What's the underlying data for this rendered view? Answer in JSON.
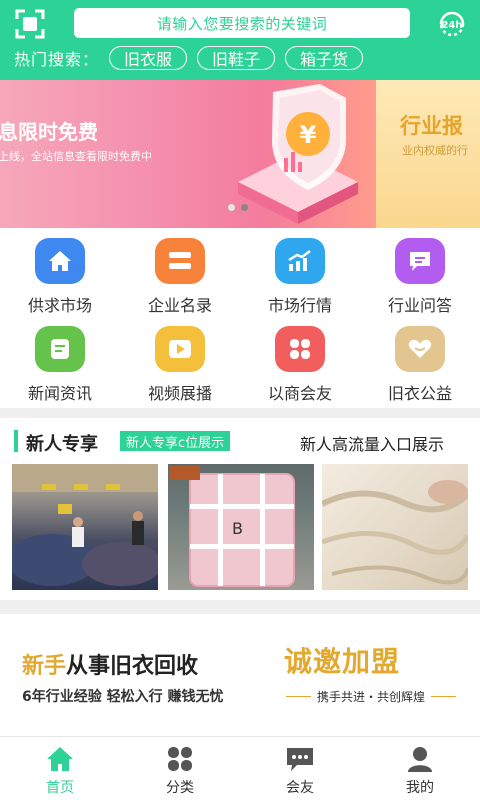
{
  "header": {
    "search_placeholder": "请输入您要搜索的关键词",
    "hot_label": "热门搜索：",
    "hot_tags": [
      "旧衣服",
      "旧鞋子",
      "箱子货"
    ],
    "service_label": "24h",
    "accent": "#2dd296"
  },
  "banner": {
    "slide1_title": "息限时免费",
    "slide1_sub": "上线，全站信息查看限时免费中",
    "slide2_title": "行业报",
    "slide2_sub": "业内权威的行"
  },
  "grid": [
    {
      "label": "供求市场",
      "icon": "home-icon",
      "color": "#3f88f0"
    },
    {
      "label": "企业名录",
      "icon": "list-icon",
      "color": "#f7833a"
    },
    {
      "label": "市场行情",
      "icon": "trend-chart-icon",
      "color": "#2ea7ef"
    },
    {
      "label": "行业问答",
      "icon": "chat-bubble-icon",
      "color": "#b35cf0"
    },
    {
      "label": "新闻资讯",
      "icon": "document-icon",
      "color": "#65c24a"
    },
    {
      "label": "视频展播",
      "icon": "play-icon",
      "color": "#f4c03b"
    },
    {
      "label": "以商会友",
      "icon": "four-petal-icon",
      "color": "#f25d5d"
    },
    {
      "label": "旧衣公益",
      "icon": "heart-icon",
      "color": "#e2c58f"
    }
  ],
  "newbie": {
    "title": "新人专享",
    "tag": "新人专享c位展示",
    "right": "新人高流量入口展示"
  },
  "ad": {
    "headline_highlight": "新手",
    "headline_rest": "从事旧衣回收",
    "sub": "6年行业经验 轻松入行 赚钱无忧",
    "right_title": "诚邀加盟",
    "right_sub": "携手共进・共创辉煌"
  },
  "nav": [
    {
      "label": "首页",
      "icon": "home-icon",
      "active": true
    },
    {
      "label": "分类",
      "icon": "grid-icon",
      "active": false
    },
    {
      "label": "会友",
      "icon": "chat-icon",
      "active": false
    },
    {
      "label": "我的",
      "icon": "user-icon",
      "active": false
    }
  ]
}
